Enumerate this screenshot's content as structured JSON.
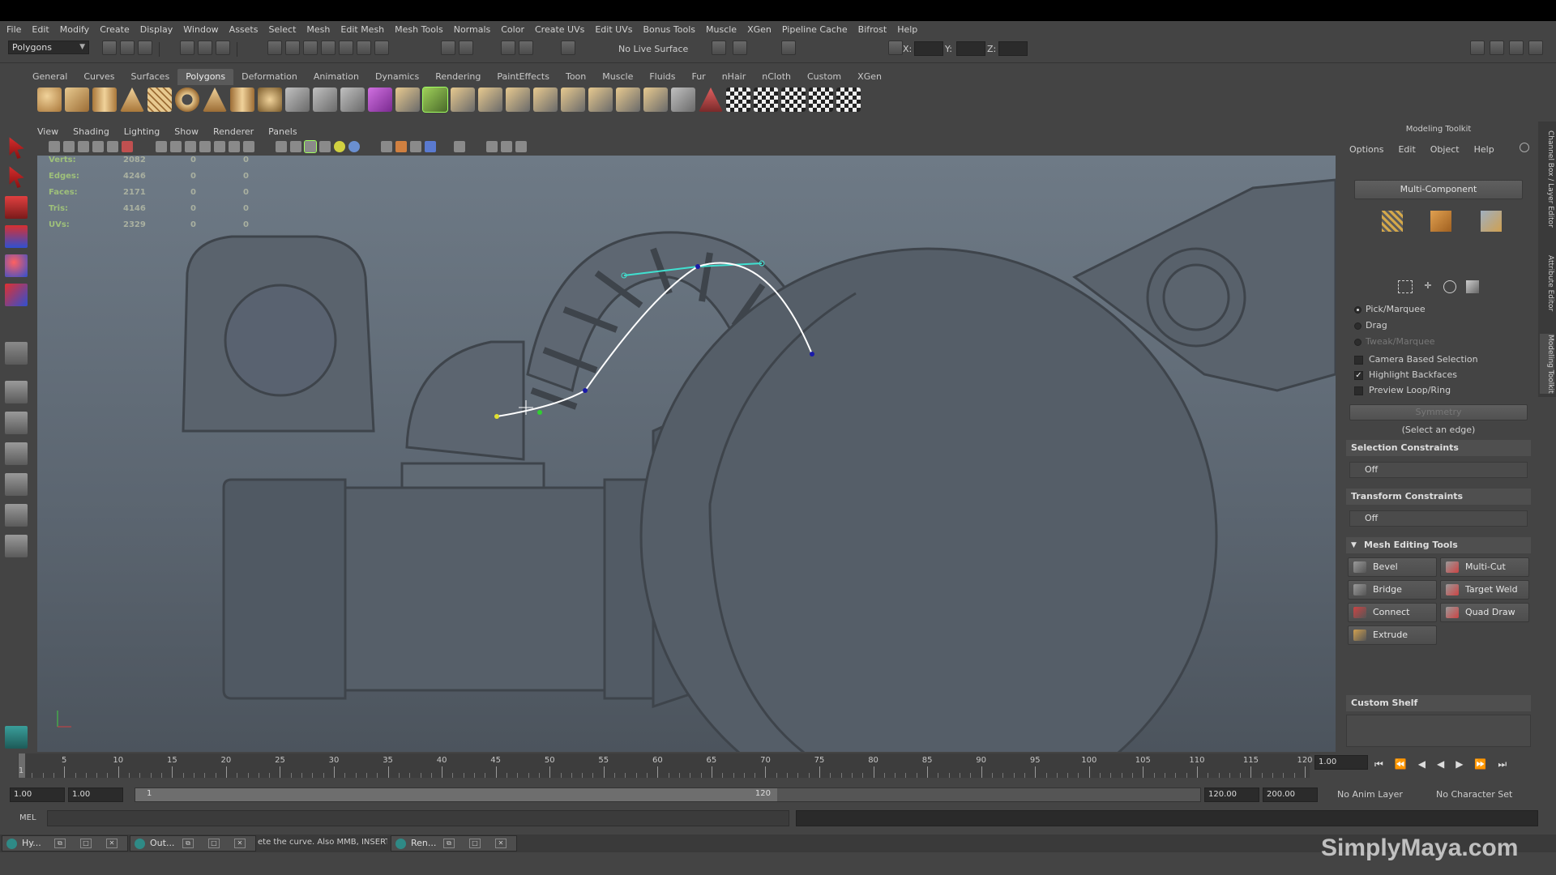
{
  "menubar": [
    "File",
    "Edit",
    "Modify",
    "Create",
    "Display",
    "Window",
    "Assets",
    "Select",
    "Mesh",
    "Edit Mesh",
    "Mesh Tools",
    "Normals",
    "Color",
    "Create UVs",
    "Edit UVs",
    "Bonus Tools",
    "Muscle",
    "XGen",
    "Pipeline Cache",
    "Bifrost",
    "Help"
  ],
  "statusline": {
    "mode": "Polygons",
    "live_surface": "No Live Surface",
    "x_label": "X:",
    "y_label": "Y:",
    "z_label": "Z:"
  },
  "shelf_tabs": [
    "General",
    "Curves",
    "Surfaces",
    "Polygons",
    "Deformation",
    "Animation",
    "Dynamics",
    "Rendering",
    "PaintEffects",
    "Toon",
    "Muscle",
    "Fluids",
    "Fur",
    "nHair",
    "nCloth",
    "Custom",
    "XGen"
  ],
  "active_shelf_tab": "Polygons",
  "viewport": {
    "menu": [
      "View",
      "Shading",
      "Lighting",
      "Show",
      "Renderer",
      "Panels"
    ],
    "hud": [
      {
        "label": "Verts:",
        "v1": "2082",
        "v2": "0",
        "v3": "0"
      },
      {
        "label": "Edges:",
        "v1": "4246",
        "v2": "0",
        "v3": "0"
      },
      {
        "label": "Faces:",
        "v1": "2171",
        "v2": "0",
        "v3": "0"
      },
      {
        "label": "Tris:",
        "v1": "4146",
        "v2": "0",
        "v3": "0"
      },
      {
        "label": "UVs:",
        "v1": "2329",
        "v2": "0",
        "v3": "0"
      }
    ]
  },
  "modeling_toolkit": {
    "title": "Modeling Toolkit",
    "menu": [
      "Options",
      "Edit",
      "Object",
      "Help"
    ],
    "multi_component": "Multi-Component",
    "pick_modes": [
      "Pick/Marquee",
      "Drag",
      "Tweak/Marquee"
    ],
    "checks": [
      {
        "label": "Camera Based Selection",
        "checked": false
      },
      {
        "label": "Highlight Backfaces",
        "checked": true
      },
      {
        "label": "Preview Loop/Ring",
        "checked": false
      }
    ],
    "symmetry": "Symmetry",
    "select_edge_hint": "(Select an edge)",
    "selection_constraints": "Selection Constraints",
    "selection_constraints_value": "Off",
    "transform_constraints": "Transform Constraints",
    "transform_constraints_value": "Off",
    "mesh_editing_tools": "Mesh Editing Tools",
    "tools": [
      "Bevel",
      "Multi-Cut",
      "Bridge",
      "Target Weld",
      "Connect",
      "Quad Draw",
      "Extrude"
    ],
    "custom_shelf": "Custom Shelf"
  },
  "side_tabs": [
    "Channel Box / Layer Editor",
    "Attribute Editor",
    "Modeling Toolkit"
  ],
  "timeline": {
    "ticks": [
      "5",
      "10",
      "15",
      "20",
      "25",
      "30",
      "35",
      "40",
      "45",
      "50",
      "55",
      "60",
      "65",
      "70",
      "75",
      "80",
      "85",
      "90",
      "95",
      "100",
      "105",
      "110",
      "115",
      "120"
    ],
    "start_tick": "1",
    "current_frame": "1.00"
  },
  "range": {
    "start": "1.00",
    "inner_start": "1.00",
    "slider_start": "1",
    "slider_end": "120",
    "end": "120.00",
    "anim_end": "200.00",
    "anim_layer": "No Anim Layer",
    "character_set": "No Character Set"
  },
  "command_line": {
    "label": "MEL"
  },
  "taskbar": [
    {
      "label": "Hy..."
    },
    {
      "label": "Out..."
    },
    {
      "label": "Ren..."
    }
  ],
  "help_line": "ete the curve. Also MMB, INSERT, E",
  "watermark": "SimplyMaya.com",
  "colors": {
    "ui_bg": "#444444",
    "viewport_top": "#6e7a86",
    "hud_label": "#9ec07a",
    "curve_white": "#ffffff",
    "curve_cyan": "#40e0d0",
    "curve_point_blue": "#1a1aa8",
    "curve_point_green": "#30d030",
    "curve_point_yellow": "#e0e030"
  }
}
